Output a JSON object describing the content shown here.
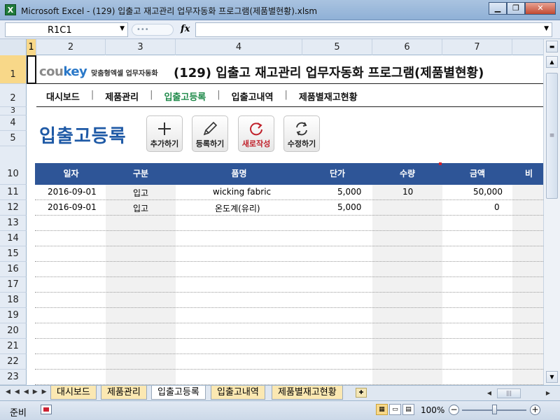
{
  "window": {
    "title": "Microsoft Excel - (129) 입출고 재고관리 업무자동화 프로그램(제품별현황).xlsm",
    "app_icon": "excel-icon",
    "buttons": [
      "minimize-icon",
      "restore-icon",
      "close-icon"
    ]
  },
  "formula_bar": {
    "name_box": "R1C1",
    "fx_label": "fx",
    "formula": ""
  },
  "columns": [
    "1",
    "2",
    "3",
    "4",
    "5",
    "6",
    "7"
  ],
  "rows": [
    "1",
    "2",
    "3",
    "4",
    "5",
    "10",
    "11",
    "12",
    "13",
    "14",
    "15",
    "16",
    "17",
    "18",
    "19",
    "20",
    "21",
    "22",
    "23"
  ],
  "selected_cell": {
    "row": "1",
    "col": "1"
  },
  "brand": {
    "logo_a": "cou",
    "logo_b": "key",
    "sub": "맞춤형엑셀 업무자동화"
  },
  "doc_title": "(129) 입출고 재고관리 업무자동화 프로그램(제품별현황)",
  "nav": {
    "items": [
      "대시보드",
      "제품관리",
      "입출고등록",
      "입출고내역",
      "제품별재고현황"
    ],
    "active": "입출고등록",
    "separator": "|"
  },
  "page_heading": "입출고등록",
  "actions": [
    {
      "label": "추가하기",
      "icon": "plus-icon"
    },
    {
      "label": "등록하기",
      "icon": "pencil-icon"
    },
    {
      "label": "새로작성",
      "icon": "refresh-red-icon"
    },
    {
      "label": "수정하기",
      "icon": "sync-arrows-icon"
    }
  ],
  "table": {
    "headers": [
      "일자",
      "구분",
      "품명",
      "단가",
      "수량",
      "금액",
      "비"
    ],
    "rows": [
      {
        "date": "2016-09-01",
        "type": "입고",
        "item": "wicking fabric",
        "price": "5,000",
        "qty": "10",
        "amount": "50,000"
      },
      {
        "date": "2016-09-01",
        "type": "입고",
        "item": "온도계(유리)",
        "price": "5,000",
        "qty": "",
        "amount": "0"
      }
    ]
  },
  "sheet_tabs": [
    "대시보드",
    "제품관리",
    "입출고등록",
    "입출고내역",
    "제품별재고현황"
  ],
  "active_sheet": "입출고등록",
  "status": {
    "ready": "준비",
    "zoom": "100%"
  }
}
